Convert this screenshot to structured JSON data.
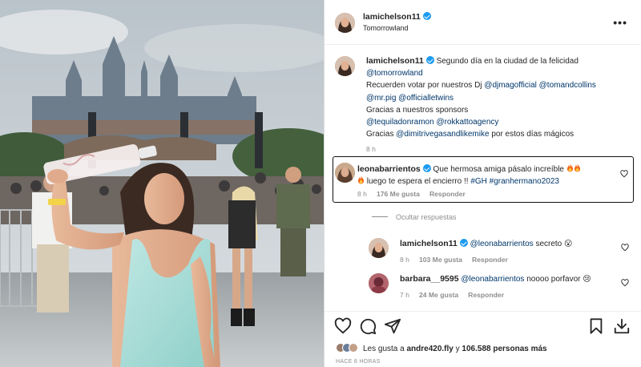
{
  "post": {
    "username": "lamichelson11",
    "location": "Tomorrowland",
    "more_label": "•••"
  },
  "caption": {
    "username": "lamichelson11",
    "line1_text": " Segundo día en la ciudad de la felicidad",
    "mention1": "@tomorrowland",
    "line3_text": "Recuerden votar por nuestros Dj ",
    "mention2": "@djmagofficial",
    "mention3": "@tomandcollins",
    "mention4": "@mr.pig",
    "mention5": "@officialletwins",
    "line5_text": "Gracias a nuestros sponsors",
    "mention6": "@tequiladonramon",
    "mention7": "@rokkattoagency",
    "line7_prefix": "Gracias ",
    "mention8": "@dimitrivegasandlikemike",
    "line7_suffix": " por estos días mágicos",
    "time": "8 h"
  },
  "comment": {
    "username": "leonabarrientos",
    "text1": " Que hermosa amiga pásalo increíble ",
    "text2": " luego te espera el encierro !! ",
    "hashtag1": "#GH",
    "hashtag2": "#granhermano2023",
    "time": "8 h",
    "likes": "176 Me gusta",
    "reply_label": "Responder"
  },
  "hide_replies_label": "Ocultar respuestas",
  "replies": [
    {
      "username": "lamichelson11",
      "mention": "@leonabarrientos",
      "text": " secreto ",
      "emoji": "😮",
      "time": "8 h",
      "likes": "103 Me gusta",
      "reply_label": "Responder"
    },
    {
      "username": "barbara__9595",
      "mention": "@leonabarrientos",
      "text": " noooo porfavor ",
      "emoji": "😢",
      "time": "7 h",
      "likes": "24 Me gusta",
      "reply_label": "Responder"
    }
  ],
  "likes_line": {
    "prefix": "Les gusta a ",
    "user": "andre420.fly",
    "middle": " y ",
    "count": "106.588 personas más"
  },
  "posted_ago": "HACE 8 HORAS",
  "icons": [
    "heart-icon",
    "comment-icon",
    "share-icon",
    "bookmark-icon",
    "download-icon",
    "verified-icon",
    "fire-emoji"
  ],
  "colors": {
    "link": "#00376b",
    "verified": "#1d9bf0",
    "muted": "#8e8e8e"
  }
}
